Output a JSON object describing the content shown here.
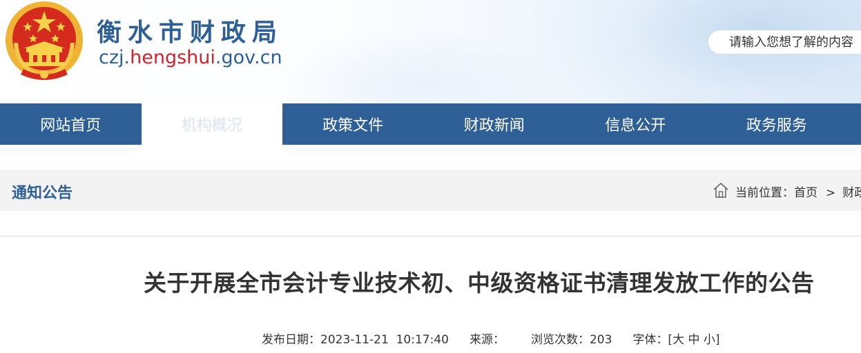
{
  "header": {
    "site_name": "衡水市财政局",
    "domain_prefix": "czj.",
    "domain_highlight": "hengshui",
    "domain_suffix": ".gov.cn",
    "search": {
      "placeholder": "请输入您想了解的内容"
    }
  },
  "nav": {
    "items": [
      {
        "label": "网站首页"
      },
      {
        "label": "机构概况"
      },
      {
        "label": "政策文件"
      },
      {
        "label": "财政新闻"
      },
      {
        "label": "信息公开"
      },
      {
        "label": "政务服务"
      }
    ]
  },
  "section": {
    "title": "通知公告",
    "breadcrumb": {
      "prefix": "当前位置：",
      "home": "首页",
      "separator": ">",
      "current": "财政"
    }
  },
  "article": {
    "title": "关于开展全市会计专业技术初、中级资格证书清理发放工作的公告",
    "meta": {
      "date_label": "发布日期：",
      "date_value": "2023-11-21  10:17:40",
      "source_label": "来源：",
      "views_label": "浏览次数：",
      "views_value": "203",
      "font_label": "字体：",
      "font_open": "[",
      "font_large": "大",
      "font_medium": "中",
      "font_small": "小",
      "font_close": "]"
    }
  },
  "colors": {
    "brand_blue": "#2f5f97",
    "domain_red": "#d0232a",
    "emblem_gold": "#f5c24a",
    "emblem_red": "#d52b1e"
  },
  "icons": {
    "emblem": "national-emblem-icon",
    "home": "home-icon"
  }
}
